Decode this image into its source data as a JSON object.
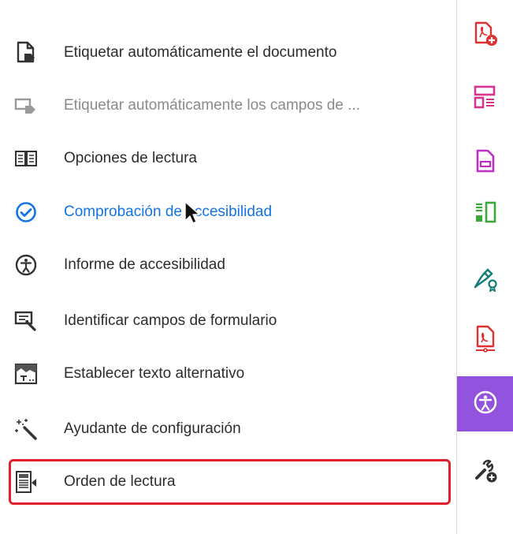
{
  "menu": {
    "items": [
      {
        "label": "Etiquetar automáticamente el documento",
        "icon": "auto-tag-document-icon",
        "state": "normal"
      },
      {
        "label": "Etiquetar automáticamente los campos de ...",
        "icon": "auto-tag-fields-icon",
        "state": "disabled"
      },
      {
        "label": "Opciones de lectura",
        "icon": "reading-options-icon",
        "state": "normal"
      },
      {
        "label": "Comprobación de accesibilidad",
        "icon": "check-circle-icon",
        "state": "link"
      },
      {
        "label": "Informe de accesibilidad",
        "icon": "accessibility-report-icon",
        "state": "normal"
      },
      {
        "label": "Identificar campos de formulario",
        "icon": "identify-form-fields-icon",
        "state": "normal"
      },
      {
        "label": "Establecer texto alternativo",
        "icon": "alt-text-icon",
        "state": "normal"
      },
      {
        "label": "Ayudante de configuración",
        "icon": "magic-wand-icon",
        "state": "normal"
      },
      {
        "label": "Orden de lectura",
        "icon": "reading-order-icon",
        "state": "highlighted"
      }
    ]
  },
  "rail": {
    "tools": [
      {
        "icon": "create-pdf-icon"
      },
      {
        "icon": "prepare-form-icon"
      },
      {
        "icon": "export-pdf-icon"
      },
      {
        "icon": "organize-pages-icon"
      },
      {
        "icon": "fill-sign-icon"
      },
      {
        "icon": "protect-pdf-icon"
      },
      {
        "icon": "accessibility-icon",
        "active": true
      },
      {
        "icon": "more-tools-icon"
      }
    ]
  },
  "colors": {
    "link": "#1473e6",
    "highlight_border": "#e0202b",
    "active_tool_bg": "#9254de",
    "text": "#2c2c2c",
    "disabled_text": "#8a8a8a"
  }
}
